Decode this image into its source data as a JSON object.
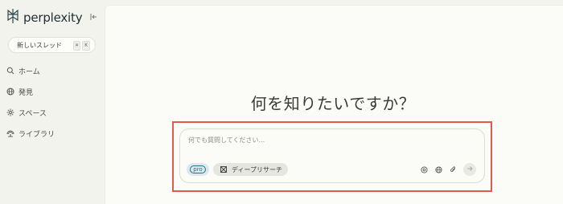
{
  "app": {
    "name": "perplexity"
  },
  "sidebar": {
    "collapse_icon": "collapse-left-icon",
    "new_thread": {
      "label": "新しいスレッド",
      "shortcut": [
        "⌘",
        "K"
      ]
    },
    "items": [
      {
        "label": "ホーム",
        "icon": "search-icon"
      },
      {
        "label": "発見",
        "icon": "globe-icon"
      },
      {
        "label": "スペース",
        "icon": "spaces-icon"
      },
      {
        "label": "ライブラリ",
        "icon": "library-icon"
      }
    ]
  },
  "main": {
    "headline": "何を知りたいですか？",
    "input": {
      "placeholder": "何でも質問してください...",
      "pro_label": "pro",
      "deep_research_label": "ディープリサーチ",
      "tools": [
        "source-icon",
        "globe-icon",
        "attach-icon"
      ],
      "submit_icon": "arrow-right-icon"
    }
  },
  "colors": {
    "highlight": "#e25a4e",
    "brand": "#1f2f30",
    "pro": "#2b6f82"
  }
}
